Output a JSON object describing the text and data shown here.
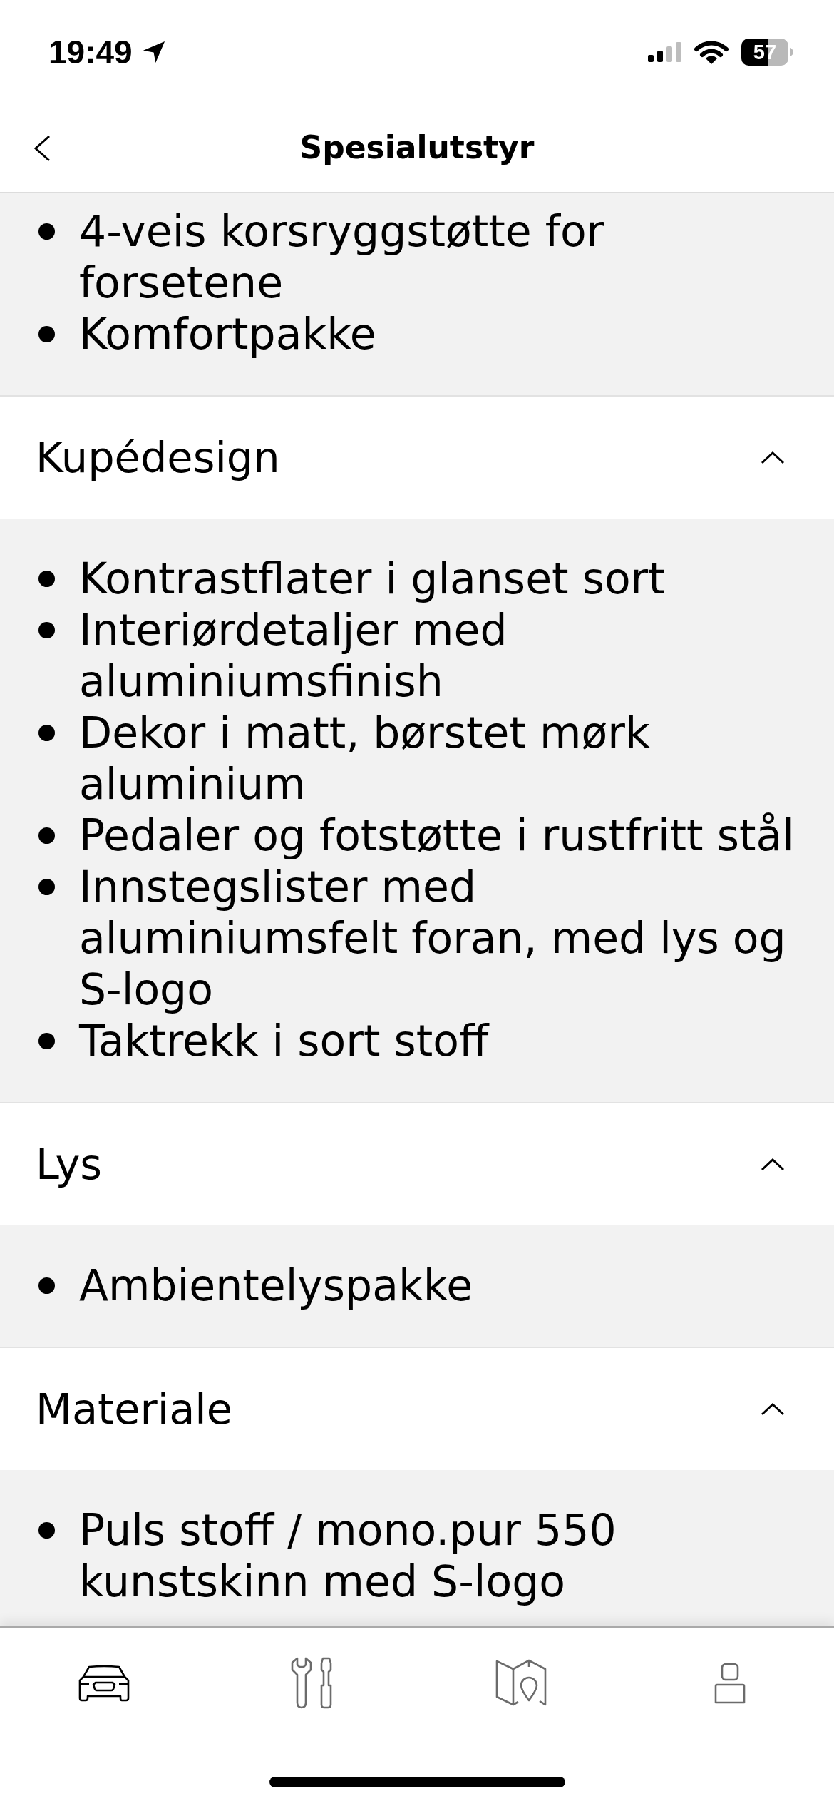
{
  "status_bar": {
    "time": "19:49",
    "battery": "57"
  },
  "header": {
    "title": "Spesialutstyr"
  },
  "sections": [
    {
      "expanded": true,
      "items": [
        "4-veis korsryggstøtte for forsetene",
        "Komfortpakke"
      ]
    },
    {
      "title": "Kupédesign",
      "expanded": true,
      "items": [
        "Kontrastflater i glanset sort",
        "Interiørdetaljer med aluminiumsfinish",
        "Dekor i matt, børstet mørk aluminium",
        "Pedaler og fotstøtte i rustfritt stål",
        "Innstegslister med aluminiumsfelt foran, med lys og S-logo",
        "Taktrekk i sort stoff"
      ]
    },
    {
      "title": "Lys",
      "expanded": true,
      "items": [
        "Ambientelyspakke"
      ]
    },
    {
      "title": "Materiale",
      "expanded": true,
      "items": [
        "Puls stoff / mono.pur 550 kunstskinn med S-logo"
      ]
    }
  ],
  "tab_bar": [
    {
      "kind": "car",
      "selected": true
    },
    {
      "kind": "service",
      "selected": false
    },
    {
      "kind": "map",
      "selected": false
    },
    {
      "kind": "profile",
      "selected": false
    }
  ]
}
